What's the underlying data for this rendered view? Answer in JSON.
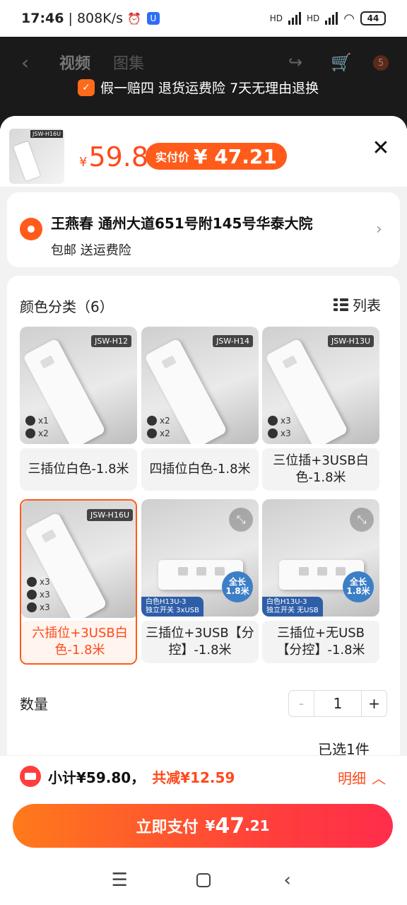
{
  "status": {
    "time": "17:46",
    "speed": "808K/s",
    "hd1": "HD",
    "hd2": "HD",
    "battery": "44"
  },
  "background": {
    "tabs": [
      "视频",
      "图集"
    ],
    "cart_count": "5",
    "guarantee": "假一赔四 退货运费险 7天无理由退换"
  },
  "product": {
    "thumb_label": "JSW-H16U",
    "price_currency": "¥",
    "price": "59.8",
    "real_price_label": "实付价",
    "real_price": "¥ 47.21"
  },
  "address": {
    "title": "王燕春 通州大道651号附145号华泰大院",
    "sub": "包邮  送运费险"
  },
  "spec": {
    "title": "颜色分类（6）",
    "list_label": "列表",
    "options": [
      {
        "label": "三插位白色-1.8米",
        "model": "JSW-H12",
        "icons": [
          "x1",
          "x2"
        ]
      },
      {
        "label": "四插位白色-1.8米",
        "model": "JSW-H14",
        "icons": [
          "x2",
          "x2"
        ]
      },
      {
        "label": "三位插+3USB白色-1.8米",
        "model": "JSW-H13U",
        "icons": [
          "x3",
          "x3"
        ]
      },
      {
        "label": "六插位+3USB白色-1.8米",
        "model": "JSW-H16U",
        "icons": [
          "x3",
          "x3",
          "x3"
        ]
      },
      {
        "label": "三插位+3USB【分控】-1.8米",
        "badge_top": "全长",
        "badge_bottom": "1.8米",
        "ribbon_top": "白色H13U-3",
        "ribbon_bottom": "独立开关 3xUSB"
      },
      {
        "label": "三插位+无USB【分控】-1.8米",
        "badge_top": "全长",
        "badge_bottom": "1.8米",
        "ribbon_top": "白色H13U-3",
        "ribbon_bottom": "独立开关 无USB"
      }
    ],
    "selected_index": 3
  },
  "quantity": {
    "label": "数量",
    "minus": "-",
    "value": "1",
    "plus": "+",
    "selected_text": "已选1件"
  },
  "footer": {
    "subtotal": "小计¥59.80，",
    "reduce": "共减¥12.59",
    "detail": "明细",
    "pay_text": "立即支付",
    "pay_currency": "¥",
    "pay_int": "47",
    "pay_dec": ".21"
  },
  "colors": {
    "accent": "#ff5b1a",
    "price": "#ff4a1c",
    "pay_start": "#ff7a1a",
    "pay_end": "#ff2d4a"
  }
}
